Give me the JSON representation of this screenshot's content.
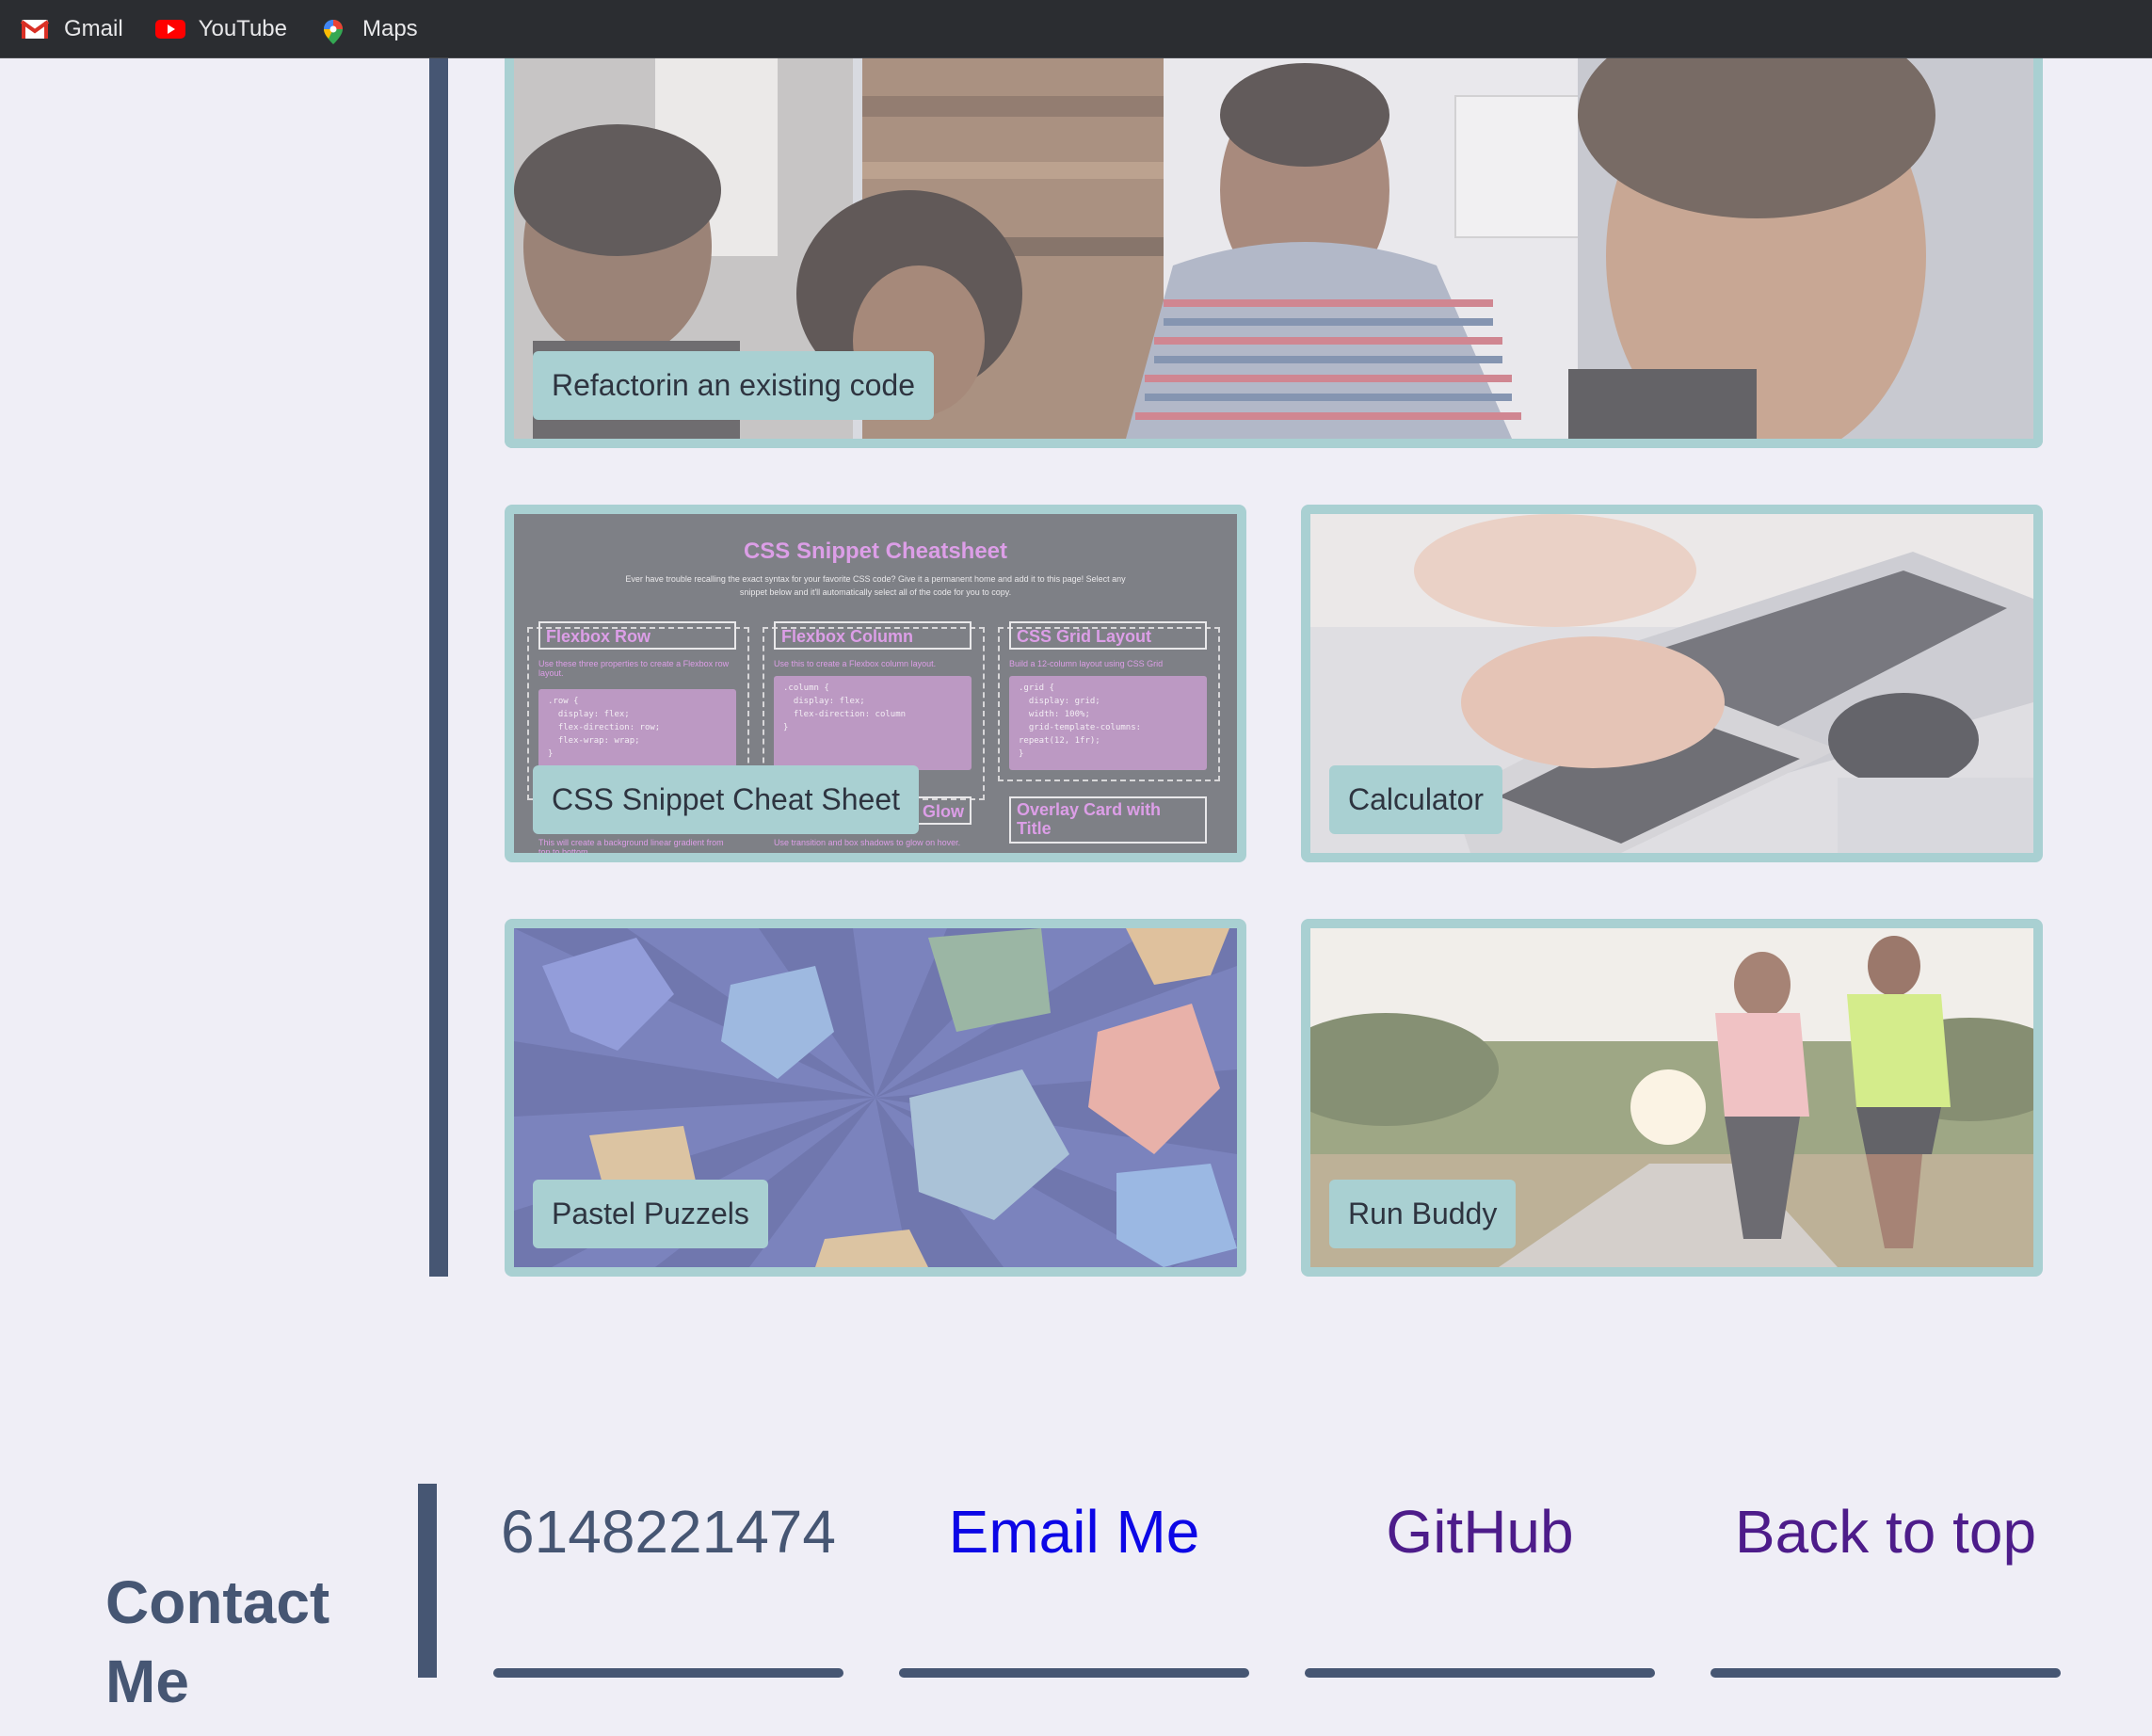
{
  "bookmarks": [
    {
      "label": "Gmail",
      "icon": "gmail-icon"
    },
    {
      "label": "YouTube",
      "icon": "youtube-icon"
    },
    {
      "label": "Maps",
      "icon": "maps-icon"
    }
  ],
  "projects": [
    {
      "label": "Refactorin an existing code"
    },
    {
      "label": "CSS Snippet Cheat Sheet"
    },
    {
      "label": "Calculator"
    },
    {
      "label": "Pastel Puzzels"
    },
    {
      "label": "Run Buddy"
    }
  ],
  "cheatsheet_preview": {
    "title": "CSS Snippet Cheatsheet",
    "subtitle": "Ever have trouble recalling the exact syntax for your favorite CSS code? Give it a permanent home and add it to this page! Select any snippet below and it'll automatically select all of the code for you to copy.",
    "cards": [
      {
        "heading": "Flexbox Row",
        "desc": "Use these three properties to create a Flexbox row layout.",
        "code": ".row {\n  display: flex;\n  flex-direction: row;\n  flex-wrap: wrap;\n}"
      },
      {
        "heading": "Flexbox Column",
        "desc": "Use this to create a Flexbox column layout.",
        "code": ".column {\n  display: flex;\n  flex-direction: column\n}"
      },
      {
        "heading": "CSS Grid Layout",
        "desc": "Build a 12-column layout using CSS Grid",
        "code": ".grid {\n  display: grid;\n  width: 100%;\n  grid-template-columns:\nrepeat(12, 1fr);\n}"
      }
    ],
    "lower_cards": [
      {
        "heading": "Glow",
        "desc": "Use transition and box shadows to glow on hover."
      },
      {
        "heading": "Overlay Card with Title",
        "desc": ""
      }
    ],
    "lower_desc_left": "This will create a background linear gradient from top to bottom."
  },
  "contact": {
    "title": "Contact Me",
    "phone": "6148221474",
    "email_label": "Email Me",
    "github_label": "GitHub",
    "top_label": "Back to top"
  },
  "colors": {
    "accent": "#465673",
    "card_border": "#a9d0d2",
    "link_blue": "#0c06e6",
    "link_visited": "#4d1c8a"
  }
}
